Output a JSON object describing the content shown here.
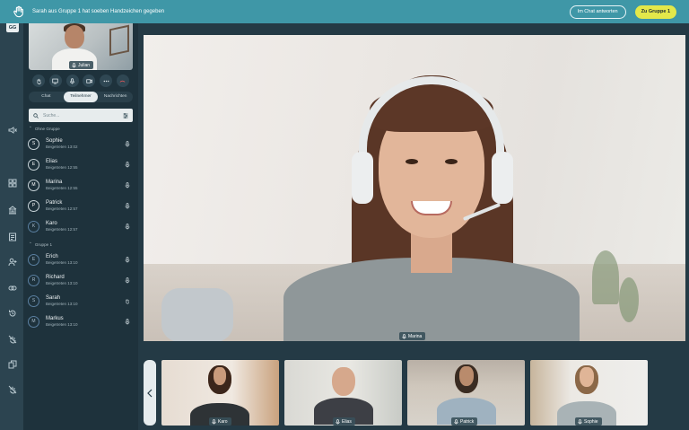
{
  "notification": {
    "message": "Sarah aus Gruppe 1 hat soeben Handzeichen gegeben",
    "reply_label": "Im Chat antworten",
    "goto_label": "Zu Gruppe 1"
  },
  "rail": {
    "avatar_initials": "GG"
  },
  "self_view": {
    "name": "Julian"
  },
  "tabs": [
    {
      "label": "Chat",
      "active": false
    },
    {
      "label": "Teilnehmer",
      "active": true
    },
    {
      "label": "Nachrichten",
      "active": false
    }
  ],
  "search": {
    "placeholder": "Suche..."
  },
  "groups": [
    {
      "title": "Ohne Gruppe",
      "members": [
        {
          "initial": "S",
          "name": "Sophie",
          "joined": "Beigetreten 13:02"
        },
        {
          "initial": "E",
          "name": "Elias",
          "joined": "Beigetreten 12:55"
        },
        {
          "initial": "M",
          "name": "Marina",
          "joined": "Beigetreten 12:55"
        },
        {
          "initial": "P",
          "name": "Patrick",
          "joined": "Beigetreten 12:57"
        },
        {
          "initial": "K",
          "name": "Karo",
          "joined": "Beigetreten 12:57"
        }
      ]
    },
    {
      "title": "Gruppe 1",
      "members": [
        {
          "initial": "E",
          "name": "Erich",
          "joined": "Beigetreten 13:10"
        },
        {
          "initial": "R",
          "name": "Richard",
          "joined": "Beigetreten 13:10"
        },
        {
          "initial": "S",
          "name": "Sarah",
          "joined": "Beigetreten 13:10"
        },
        {
          "initial": "M",
          "name": "Markus",
          "joined": "Beigetreten 13:10"
        }
      ]
    }
  ],
  "main_speaker": {
    "name": "Marina"
  },
  "thumbnails": [
    {
      "name": "Karo"
    },
    {
      "name": "Elias"
    },
    {
      "name": "Patrick"
    },
    {
      "name": "Sophie"
    }
  ],
  "colors": {
    "topbar": "#3f97a7",
    "accent_button": "#e3e84a",
    "panel": "#1e323c",
    "background": "#243a45"
  }
}
